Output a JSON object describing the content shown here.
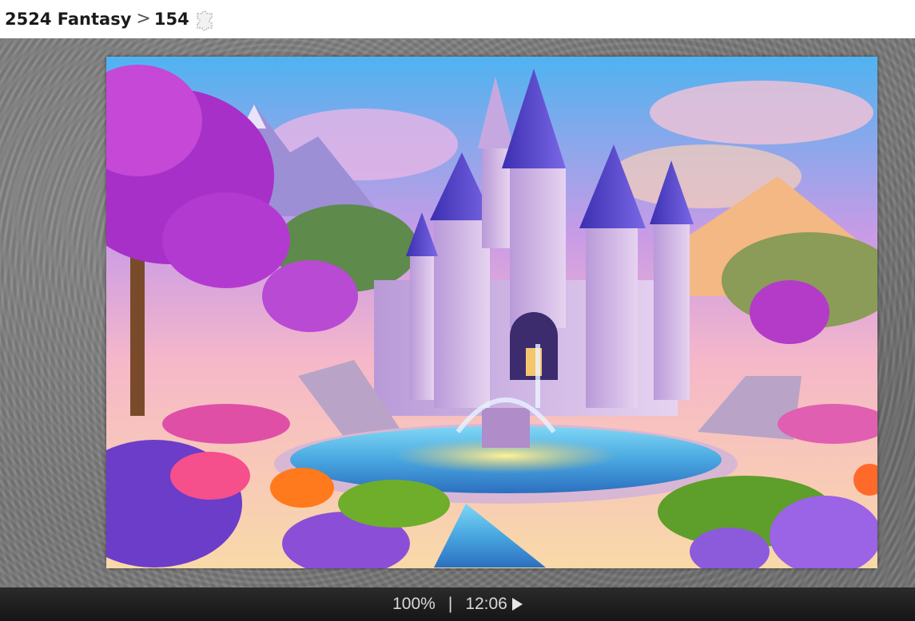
{
  "breadcrumb": {
    "category": "2524 Fantasy",
    "separator": ">",
    "puzzle_number": "154",
    "pieces_icon": "puzzle-piece-icon"
  },
  "board": {
    "image_subject": "fantasy-castle-with-fountain"
  },
  "status_bar": {
    "progress": "100%",
    "divider": "|",
    "timer": "12:06",
    "play_icon": "play-icon"
  }
}
